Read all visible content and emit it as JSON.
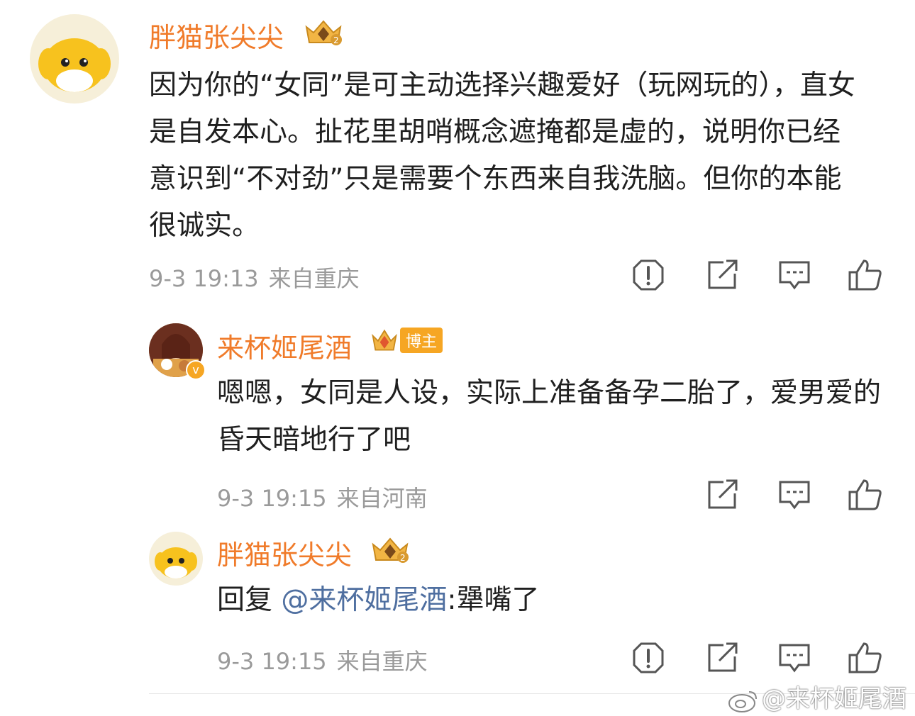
{
  "colors": {
    "name": "#f07b2a",
    "mention": "#4f6fa0",
    "meta": "#9a9a9a"
  },
  "comments": [
    {
      "user": "胖猫张尖尖",
      "text": "因为你的“女同”是可主动选择兴趣爱好（玩网玩的），直女是自发本心。扯花里胡哨概念遮掩都是虚的，说明你已经意识到“不对劲”只是需要个东西来自我洗脑。但你的本能很诚实。",
      "time": "9-3 19:13",
      "location": "来自重庆"
    },
    {
      "user": "来杯姬尾酒",
      "blogger_badge": "博主",
      "text": "嗯嗯，女同是人设，实际上准备备孕二胎了，爱男爱的昏天暗地行了吧",
      "time": "9-3 19:15",
      "location": "来自河南"
    },
    {
      "user": "胖猫张尖尖",
      "reply_prefix": "回复 ",
      "mention": "@来杯姬尾酒",
      "reply_text": ":犟嘴了",
      "time": "9-3 19:15",
      "location": "来自重庆"
    }
  ],
  "watermark": "@来杯姬尾酒",
  "icons": [
    "report-icon",
    "share-icon",
    "comment-icon",
    "like-icon"
  ]
}
